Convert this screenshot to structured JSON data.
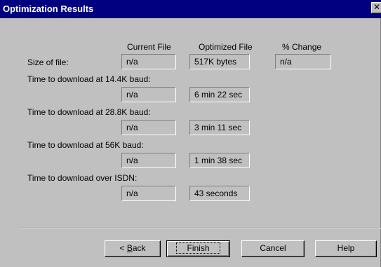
{
  "window": {
    "title": "Optimization Results",
    "close_glyph": "✕"
  },
  "columns": {
    "current": "Current File",
    "optimized": "Optimized File",
    "change": "% Change"
  },
  "rows": [
    {
      "label": "Size of file:",
      "current": "n/a",
      "optimized": "517K bytes",
      "change": "n/a"
    },
    {
      "label": "Time to download at 14.4K baud:",
      "current": "n/a",
      "optimized": "6 min 22 sec"
    },
    {
      "label": "Time to download at 28.8K baud:",
      "current": "n/a",
      "optimized": "3 min 11 sec"
    },
    {
      "label": "Time to download at 56K baud:",
      "current": "n/a",
      "optimized": "1 min 38 sec"
    },
    {
      "label": "Time to download over ISDN:",
      "current": "n/a",
      "optimized": "43 seconds"
    }
  ],
  "buttons": {
    "back_prefix": "< ",
    "back_mnemonic": "B",
    "back_rest": "ack",
    "finish": "Finish",
    "cancel": "Cancel",
    "help": "Help"
  },
  "colors": {
    "titlebar": "#000080",
    "face": "#c0c0c0"
  }
}
